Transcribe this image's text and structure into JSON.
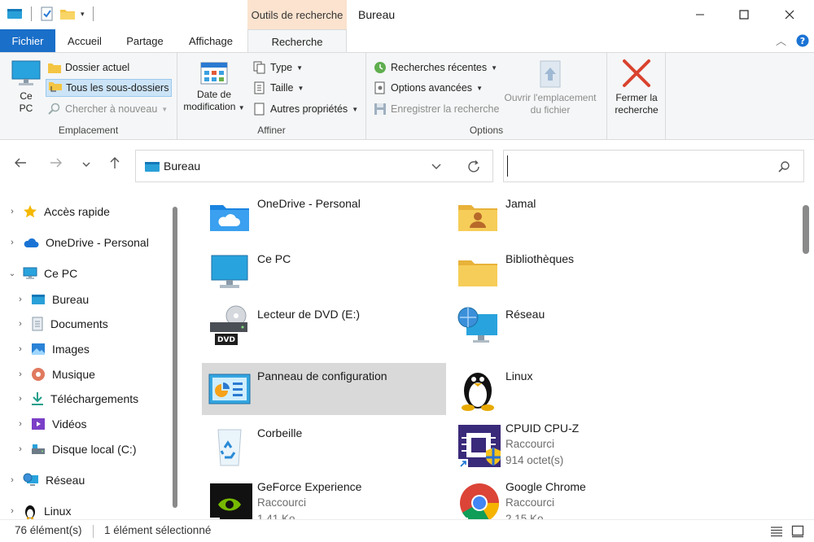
{
  "window": {
    "title": "Bureau",
    "contextual_tab_header": "Outils de recherche"
  },
  "tabs": {
    "file": "Fichier",
    "home": "Accueil",
    "share": "Partage",
    "view": "Affichage",
    "search": "Recherche"
  },
  "ribbon": {
    "emplacement": {
      "label": "Emplacement",
      "this_pc_line1": "Ce",
      "this_pc_line2": "PC",
      "current_folder": "Dossier actuel",
      "all_subfolders": "Tous les sous-dossiers",
      "search_again": "Chercher à nouveau"
    },
    "affiner": {
      "label": "Affiner",
      "date_line1": "Date de",
      "date_line2": "modification",
      "type": "Type",
      "size": "Taille",
      "other_props": "Autres propriétés"
    },
    "options": {
      "label": "Options",
      "recent_searches": "Recherches récentes",
      "advanced_options": "Options avancées",
      "save_search": "Enregistrer la recherche",
      "open_location_line1": "Ouvrir l'emplacement",
      "open_location_line2": "du fichier"
    },
    "close": {
      "line1": "Fermer la",
      "line2": "recherche"
    }
  },
  "address": {
    "path": "Bureau"
  },
  "search": {
    "placeholder": ""
  },
  "nav_tree": [
    {
      "label": "Accès rapide"
    },
    {
      "label": "OneDrive - Personal"
    },
    {
      "label": "Ce PC"
    },
    {
      "label": "Bureau"
    },
    {
      "label": "Documents"
    },
    {
      "label": "Images"
    },
    {
      "label": "Musique"
    },
    {
      "label": "Téléchargements"
    },
    {
      "label": "Vidéos"
    },
    {
      "label": "Disque local (C:)"
    },
    {
      "label": "Réseau"
    },
    {
      "label": "Linux"
    }
  ],
  "items": [
    {
      "name": "OneDrive - Personal"
    },
    {
      "name": "Jamal"
    },
    {
      "name": "Ce PC"
    },
    {
      "name": "Bibliothèques"
    },
    {
      "name": "Lecteur de DVD (E:)",
      "badge": "DVD"
    },
    {
      "name": "Réseau"
    },
    {
      "name": "Panneau de configuration"
    },
    {
      "name": "Linux"
    },
    {
      "name": "Corbeille"
    },
    {
      "name": "CPUID CPU-Z",
      "type": "Raccourci",
      "size": "914 octet(s)"
    },
    {
      "name": "GeForce Experience",
      "type": "Raccourci",
      "size": "1,41 Ko"
    },
    {
      "name": "Google Chrome",
      "type": "Raccourci",
      "size": "2,15 Ko"
    }
  ],
  "status": {
    "count": "76 élément(s)",
    "selected": "1 élément sélectionné"
  },
  "colors": {
    "file_tab": "#1a6fc9",
    "contextual_header": "#fbe3cf",
    "selection": "#cce4f7",
    "selected_tile": "#d9d9d9",
    "close_red": "#d9432f"
  }
}
